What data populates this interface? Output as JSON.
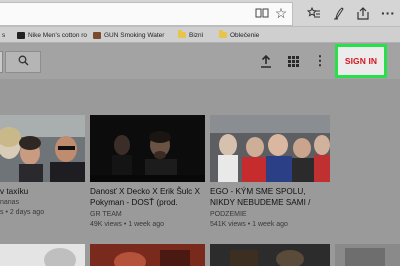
{
  "browser": {
    "favorites": [
      {
        "label": "Nike Men's cotton ro",
        "icon": "nike-swoosh-icon"
      },
      {
        "label": "GUN Smoking Water",
        "icon": "page-favicon-icon"
      },
      {
        "label": "Biznì",
        "icon": "folder-icon"
      },
      {
        "label": "Oblečenie",
        "icon": "folder-icon"
      }
    ],
    "tab_fragment": "s"
  },
  "youtube": {
    "signin_label": "SIGN IN"
  },
  "videos": [
    {
      "title_line1": "v taxíku",
      "title_line2": "",
      "channel": "nanas",
      "views": "s • 2 days ago"
    },
    {
      "title_line1": "Danosť X Decko X Erik Šulc X",
      "title_line2": "Pokyman - DOSŤ (prod.",
      "channel": "GR TEAM",
      "views": "49K views • 1 week ago"
    },
    {
      "title_line1": "EGO - KÝM SME SPOLU,",
      "title_line2": "NIKDY NEBUDEME SAMI /",
      "channel": "PODZEMIE",
      "views": "541K views • 1 week ago"
    }
  ],
  "colors": {
    "signin_red": "#d4161d",
    "highlight_green": "#28e04a"
  }
}
